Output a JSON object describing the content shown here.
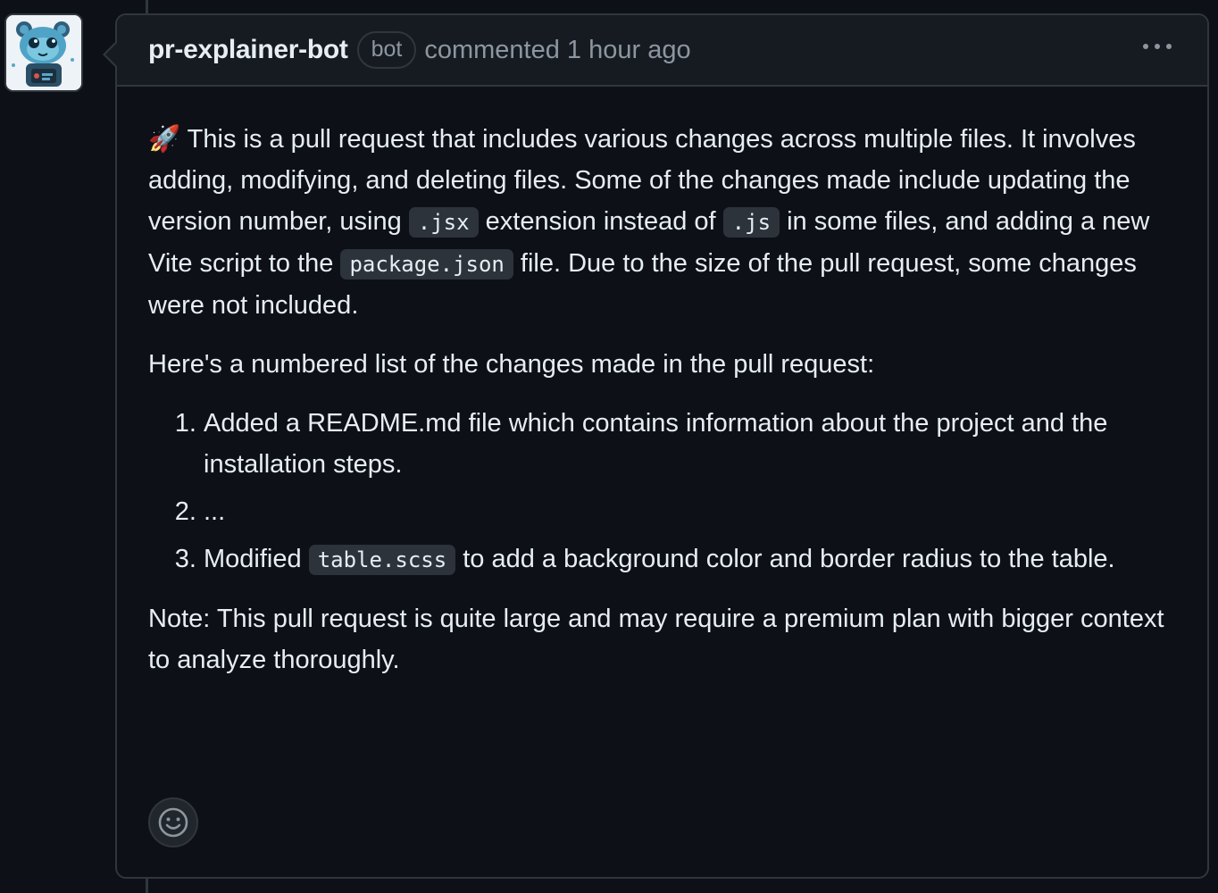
{
  "comment": {
    "author": "pr-explainer-bot",
    "badge": "bot",
    "action": "commented",
    "timestamp": "1 hour ago",
    "avatar_icon": "robot-cat-avatar-icon",
    "menu_icon": "kebab-horizontal-icon",
    "body": {
      "intro_emoji": "🚀",
      "intro_part1": "This is a pull request that includes various changes across multiple files. It involves adding, modifying, and deleting files. Some of the changes made include updating the version number, using",
      "code_jsx": ".jsx",
      "intro_part2": "extension instead of",
      "code_js": ".js",
      "intro_part3": "in some files, and adding a new Vite script to the",
      "code_package_json": "package.json",
      "intro_part4": "file. Due to the size of the pull request, some changes were not included.",
      "list_intro": "Here's a numbered list of the changes made in the pull request:",
      "items": [
        {
          "text": "Added a README.md file which contains information about the project and the installation steps."
        },
        {
          "text": "..."
        },
        {
          "prefix": "Modified",
          "code": "table.scss",
          "suffix": "to add a background color and border radius to the table."
        }
      ],
      "note": "Note: This pull request is quite large and may require a premium plan with bigger context to analyze thoroughly."
    },
    "reaction_icon": "smiley-icon"
  },
  "colors": {
    "background": "#0d1117",
    "header_bg": "#161b22",
    "border": "#30363d",
    "text": "#e6edf3",
    "muted": "#8d96a0",
    "code_bg": "#2d333b"
  }
}
